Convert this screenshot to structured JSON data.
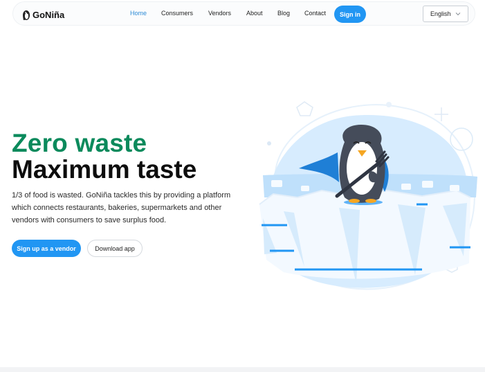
{
  "brand": {
    "name": "GoNiña"
  },
  "nav": {
    "items": [
      {
        "label": "Home",
        "active": true
      },
      {
        "label": "Consumers"
      },
      {
        "label": "Vendors"
      },
      {
        "label": "About"
      },
      {
        "label": "Blog"
      },
      {
        "label": "Contact"
      }
    ],
    "signin_label": "Sign in",
    "language": {
      "selected": "English"
    }
  },
  "hero": {
    "title_line1": "Zero waste",
    "title_line2": "Maximum taste",
    "description": "1/3 of food is wasted. GoNiña tackles this by providing a platform which connects restaurants, bakeries, supermarkets and other vendors with consumers to save surplus food.",
    "primary_cta": "Sign up as a vendor",
    "secondary_cta": "Download app"
  },
  "colors": {
    "accent_blue": "#2196f3",
    "title_green": "#0b8a5c",
    "active_nav": "#2d8bd6"
  },
  "icons": {
    "logo": "penguin-logo-icon",
    "language_chevron": "chevron-down-icon",
    "illustration": "penguin-on-iceberg-illustration"
  }
}
